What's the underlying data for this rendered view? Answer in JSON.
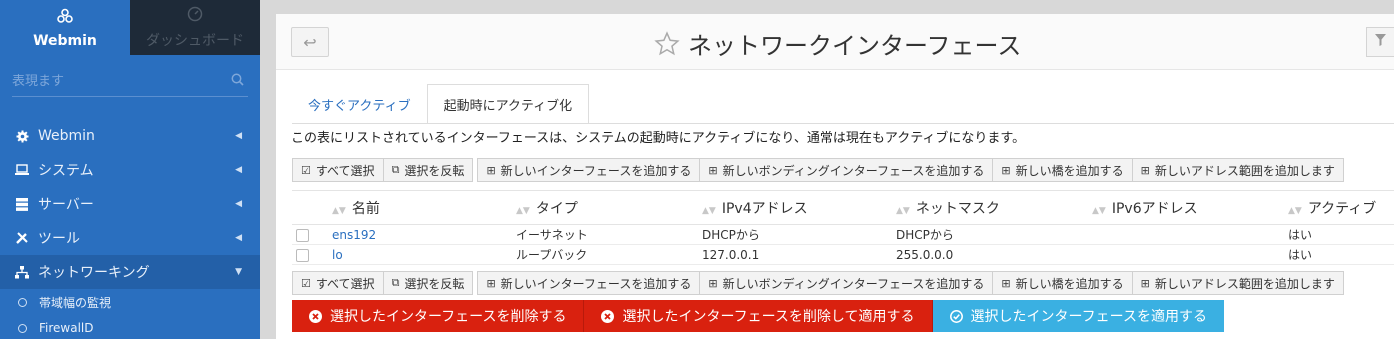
{
  "sidebar": {
    "brand": {
      "label": "Webmin"
    },
    "dashboard": {
      "label": "ダッシュボード"
    },
    "search": {
      "placeholder": "表現ます"
    },
    "items": [
      {
        "label": "Webmin",
        "icon": "gear-icon"
      },
      {
        "label": "システム",
        "icon": "laptop-icon"
      },
      {
        "label": "サーバー",
        "icon": "server-icon"
      },
      {
        "label": "ツール",
        "icon": "tools-icon"
      },
      {
        "label": "ネットワーキング",
        "icon": "network-icon"
      }
    ],
    "subitems": [
      {
        "label": "帯域幅の監視"
      },
      {
        "label": "FirewallD"
      }
    ]
  },
  "header": {
    "title": "ネットワークインターフェース"
  },
  "tabs": [
    {
      "label": "今すぐアクティブ"
    },
    {
      "label": "起動時にアクティブ化"
    }
  ],
  "description": "この表にリストされているインターフェースは、システムの起動時にアクティブになり、通常は現在もアクティブになります。",
  "toolbar": {
    "select_all": "すべて選択",
    "invert": "選択を反転",
    "add_iface": "新しいインターフェースを追加する",
    "add_bond": "新しいボンディングインターフェースを追加する",
    "add_bridge": "新しい橋を追加する",
    "add_range": "新しいアドレス範囲を追加します"
  },
  "table": {
    "headers": [
      "名前",
      "タイプ",
      "IPv4アドレス",
      "ネットマスク",
      "IPv6アドレス",
      "アクティブ"
    ],
    "rows": [
      {
        "name": "ens192",
        "type": "イーサネット",
        "ipv4": "DHCPから",
        "netmask": "DHCPから",
        "ipv6": "",
        "active": "はい"
      },
      {
        "name": "lo",
        "type": "ループバック",
        "ipv4": "127.0.0.1",
        "netmask": "255.0.0.0",
        "ipv6": "",
        "active": "はい"
      }
    ]
  },
  "actions": {
    "delete": "選択したインターフェースを削除する",
    "delete_apply": "選択したインターフェースを削除して適用する",
    "apply": "選択したインターフェースを適用する"
  },
  "colors": {
    "sidebar": "#2a6fbf",
    "danger": "#d9210f",
    "info": "#3ab0e2"
  }
}
